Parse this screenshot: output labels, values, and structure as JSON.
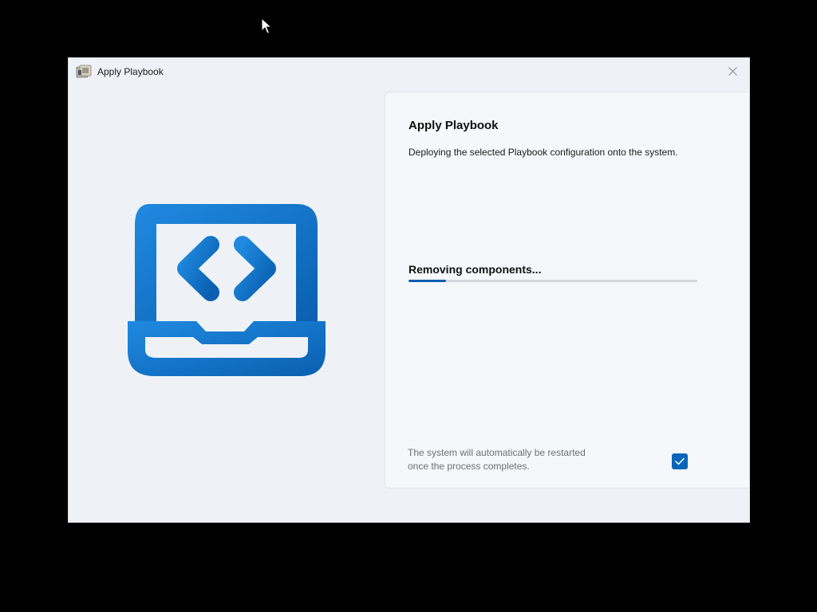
{
  "window": {
    "title": "Apply Playbook"
  },
  "panel": {
    "heading": "Apply Playbook",
    "description": "Deploying the selected Playbook configuration onto the system.",
    "status": "Removing components...",
    "progress": 0.13,
    "restart_note_line1": "The system will automatically be restarted",
    "restart_note_line2": "once the process completes.",
    "restart_checkbox_checked": true
  },
  "icons": {
    "app": "playbook-app-icon",
    "close": "close-icon",
    "illustration": "laptop-code-icon",
    "check": "checkmark-icon",
    "cursor": "mouse-pointer-icon"
  },
  "colors": {
    "accent": "#0a64b8",
    "window_bg": "#eef2f7",
    "panel_bg": "#f5f7fa",
    "desktop_bg": "#000000"
  }
}
